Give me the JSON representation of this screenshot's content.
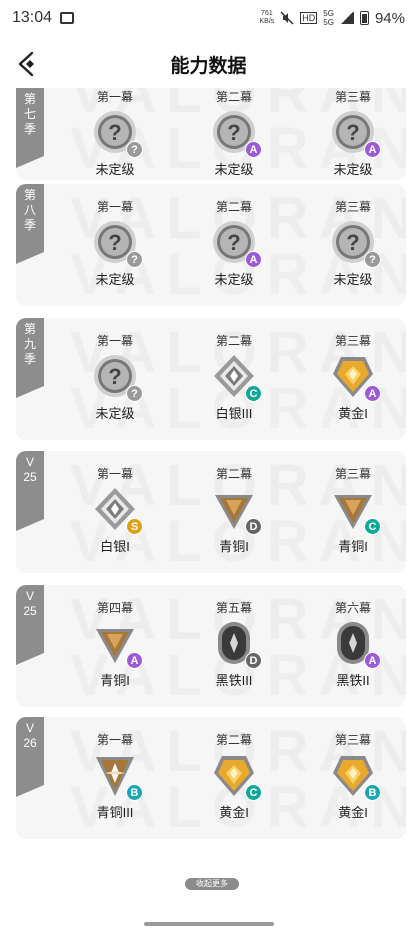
{
  "status": {
    "time": "13:04",
    "speed": "761",
    "speed_unit": "KB/s",
    "hd": "HD",
    "net1": "5G",
    "net2": "5G",
    "battery": "94%"
  },
  "header": {
    "title": "能力数据"
  },
  "watermark": "VALORANT",
  "cards": [
    {
      "season": "第七季",
      "acts": [
        {
          "act": "第一幕",
          "rank": "未定级",
          "icon": "unranked",
          "tier": "?"
        },
        {
          "act": "第二幕",
          "rank": "未定级",
          "icon": "unranked",
          "tier": "A"
        },
        {
          "act": "第三幕",
          "rank": "未定级",
          "icon": "unranked",
          "tier": "A"
        }
      ]
    },
    {
      "season": "第八季",
      "acts": [
        {
          "act": "第一幕",
          "rank": "未定级",
          "icon": "unranked",
          "tier": "?"
        },
        {
          "act": "第二幕",
          "rank": "未定级",
          "icon": "unranked",
          "tier": "A"
        },
        {
          "act": "第三幕",
          "rank": "未定级",
          "icon": "unranked",
          "tier": "?"
        }
      ]
    },
    {
      "season": "第九季",
      "acts": [
        {
          "act": "第一幕",
          "rank": "未定级",
          "icon": "unranked",
          "tier": "?"
        },
        {
          "act": "第二幕",
          "rank": "白银III",
          "icon": "silver",
          "tier": "C"
        },
        {
          "act": "第三幕",
          "rank": "黄金I",
          "icon": "gold",
          "tier": "A"
        }
      ]
    },
    {
      "season": "V25",
      "acts": [
        {
          "act": "第一幕",
          "rank": "白银I",
          "icon": "silver",
          "tier": "S"
        },
        {
          "act": "第二幕",
          "rank": "青铜I",
          "icon": "bronze",
          "tier": "D"
        },
        {
          "act": "第三幕",
          "rank": "青铜I",
          "icon": "bronze",
          "tier": "C"
        }
      ]
    },
    {
      "season": "V25",
      "acts": [
        {
          "act": "第四幕",
          "rank": "青铜I",
          "icon": "bronze",
          "tier": "A"
        },
        {
          "act": "第五幕",
          "rank": "黑铁III",
          "icon": "iron",
          "tier": "D"
        },
        {
          "act": "第六幕",
          "rank": "黑铁II",
          "icon": "iron",
          "tier": "A"
        }
      ]
    },
    {
      "season": "V26",
      "acts": [
        {
          "act": "第一幕",
          "rank": "青铜III",
          "icon": "bronze3",
          "tier": "B"
        },
        {
          "act": "第二幕",
          "rank": "黄金I",
          "icon": "gold",
          "tier": "C"
        },
        {
          "act": "第三幕",
          "rank": "黄金I",
          "icon": "gold",
          "tier": "B"
        }
      ]
    }
  ],
  "collapse_label": "收起更多"
}
